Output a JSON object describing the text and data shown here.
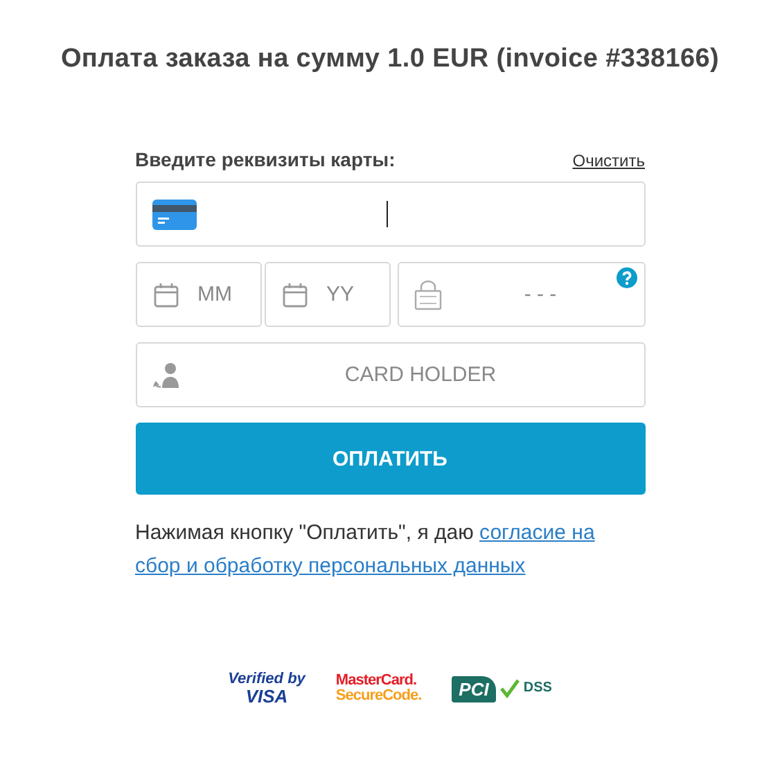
{
  "title": "Оплата заказа на сумму 1.0 EUR (invoice #338166)",
  "form": {
    "label": "Введите реквизиты карты:",
    "clear_link": "Очистить",
    "card_number": {
      "focused": true
    },
    "expiry_month": {
      "placeholder": "MM"
    },
    "expiry_year": {
      "placeholder": "YY"
    },
    "cvv": {
      "placeholder": "- - -"
    },
    "card_holder": {
      "placeholder": "CARD HOLDER"
    },
    "pay_button": "ОПЛАТИТЬ"
  },
  "consent": {
    "text": "Нажимая кнопку \"Оплатить\", я даю",
    "links": [
      "согласие на",
      "сбор и обработку персональных данных"
    ]
  },
  "logos": [
    {
      "kind": "visa",
      "lines": [
        "Verified by",
        "VISA"
      ]
    },
    {
      "kind": "mastercard",
      "lines": [
        "MasterCard.",
        "SecureCode."
      ]
    },
    {
      "kind": "pci",
      "lines": [
        "PCI",
        "DSS"
      ]
    }
  ]
}
